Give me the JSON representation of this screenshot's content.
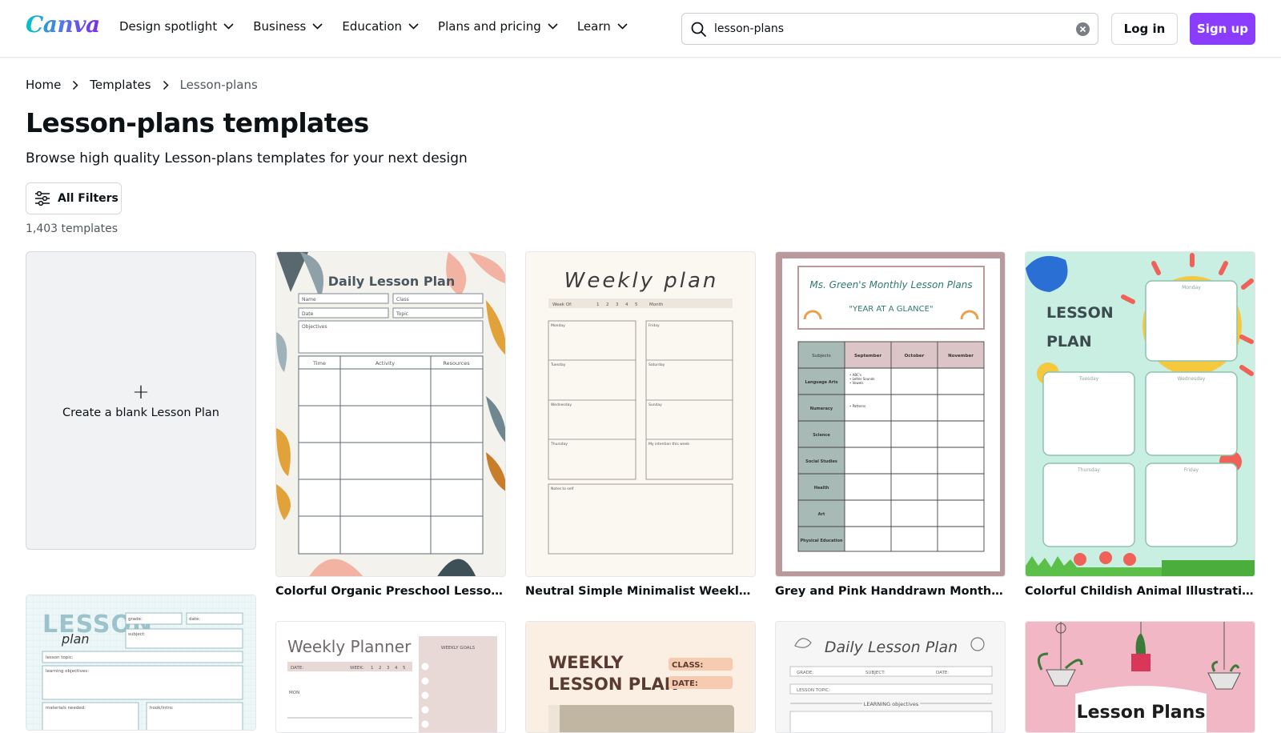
{
  "header": {
    "logo": "Canva",
    "nav": [
      "Design spotlight",
      "Business",
      "Education",
      "Plans and pricing",
      "Learn"
    ],
    "search_value": "lesson-plans",
    "login_label": "Log in",
    "signup_label": "Sign up"
  },
  "breadcrumb": {
    "home": "Home",
    "templates": "Templates",
    "current": "Lesson-plans"
  },
  "page": {
    "title": "Lesson-plans templates",
    "subtitle": "Browse high quality Lesson-plans templates for your next design",
    "filters_label": "All Filters",
    "count": "1,403 templates"
  },
  "blank_card": {
    "label": "Create a blank Lesson Plan"
  },
  "templates": [
    {
      "title": "Colorful Organic Preschool Lesson Plan",
      "thumb": {
        "heading": "Daily Lesson Plan",
        "fields": [
          "Name",
          "Class",
          "Date",
          "Topic",
          "Objectives"
        ],
        "columns": [
          "Time",
          "Activity",
          "Resources"
        ]
      }
    },
    {
      "title": "Neutral Simple Minimalist Weekly Lesson Plan",
      "thumb": {
        "heading": "Weekly plan",
        "week_label": "Week Of:",
        "week_numbers": [
          "1",
          "2",
          "3",
          "4",
          "5"
        ],
        "month_label": "Month",
        "days": [
          "Monday",
          "Friday",
          "Tuesday",
          "Saturday",
          "Wednesday",
          "Sunday",
          "Thursday",
          "My intention this week"
        ],
        "notes_label": "Notes to self"
      }
    },
    {
      "title": "Grey and Pink Handdrawn Monthly Lesson Plan",
      "thumb": {
        "heading": "Ms. Green's Monthly Lesson Plans",
        "subheading": "\"YEAR AT A GLANCE\"",
        "columns": [
          "Subjects",
          "September",
          "October",
          "November"
        ],
        "subjects": [
          "Language Arts",
          "Numeracy",
          "Science",
          "Social Studies",
          "Health",
          "Art",
          "Physical Education"
        ],
        "notes": [
          "• ABC's",
          "• Letter Sounds",
          "• Vowels",
          "• Patterns"
        ]
      }
    },
    {
      "title": "Colorful Childish Animal Illustration Lesson Plan",
      "thumb": {
        "heading_line1": "LESSON",
        "heading_line2": "PLAN",
        "days": [
          "Monday",
          "Tuesday",
          "Wednesday",
          "Thursday",
          "Friday"
        ]
      }
    }
  ],
  "row2": [
    {
      "thumb": {
        "heading_line1": "LESSON",
        "heading_line2": "plan",
        "fields": [
          "grade:",
          "date:",
          "subject:",
          "lesson topic:",
          "learning objectives:",
          "materials needed:",
          "hook/intro:"
        ]
      }
    },
    {
      "thumb": {
        "heading": "Weekly Planner",
        "goals_label": "WEEKLY GOALS",
        "date_label": "DATE:",
        "week_label": "WEEK:",
        "week_numbers": [
          "1",
          "2",
          "3",
          "4",
          "5"
        ],
        "day_label": "MON"
      }
    },
    {
      "thumb": {
        "heading_line1": "WEEKLY",
        "heading_line2": "LESSON PLAN",
        "class_label": "CLASS:",
        "date_label": "DATE:"
      }
    },
    {
      "thumb": {
        "heading": "Daily Lesson Plan",
        "fields": [
          "GRADE:",
          "SUBJECT:",
          "DATE:",
          "LESSON TOPIC:"
        ],
        "objectives_label": "LEARNING objectives"
      }
    },
    {
      "thumb": {
        "heading": "Lesson Plans"
      }
    }
  ],
  "colors": {
    "brand_purple": "#8b3dff",
    "text": "#0d1216",
    "muted": "#51575e"
  }
}
